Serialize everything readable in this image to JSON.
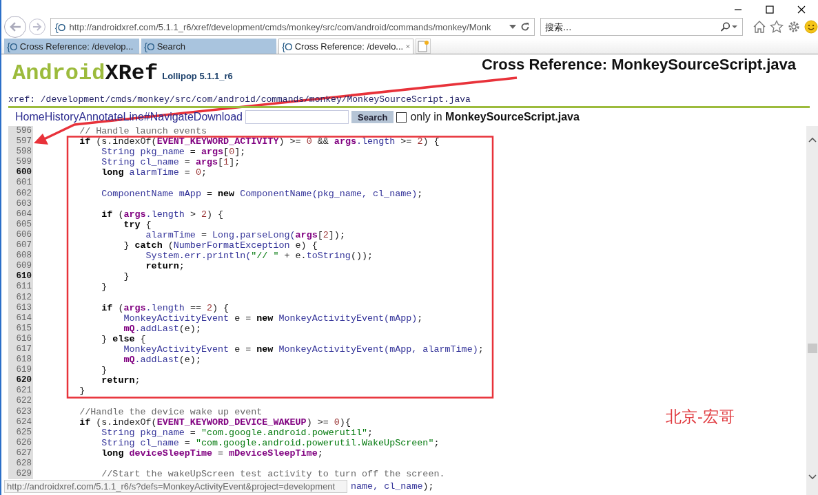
{
  "browser": {
    "url": "http://androidxref.com/5.1.1_r6/xref/development/cmds/monkey/src/com/android/commands/monkey/Monk",
    "url_favicon": "{O",
    "search": {
      "placeholder": "搜索..."
    }
  },
  "tabs": [
    {
      "favicon": "{O",
      "label": "Cross Reference: /develop...",
      "selected": false
    },
    {
      "favicon": "{O",
      "label": "Search",
      "selected": false
    },
    {
      "favicon": "{O",
      "label": "Cross Reference: /develo...",
      "selected": true
    }
  ],
  "header": {
    "logo": {
      "prefix": "Android",
      "suffix": "XRef"
    },
    "version": "Lollipop 5.1.1_r6",
    "title": "Cross Reference: MonkeySourceScript.java",
    "breadcrumb": "xref: /development/cmds/monkey/src/com/android/commands/monkey/MonkeySourceScript.java"
  },
  "nav": {
    "links": [
      "Home",
      "History",
      "Annotate",
      "Line#",
      "Navigate",
      "Download"
    ],
    "search_button": "Search",
    "only_checked": false,
    "only_label": "only in **MonkeySourceScript.java**"
  },
  "code": [
    {
      "num": "596",
      "bold": false,
      "segs": [
        {
          "kind": "comment",
          "text": "    // Handle launch events"
        }
      ]
    },
    {
      "num": "597",
      "bold": false,
      "segs": [
        {
          "kind": "keyword",
          "text": "    if"
        },
        {
          "kind": "plain",
          "text": " (s.indexOf("
        },
        {
          "kind": "field",
          "text": "EVENT_KEYWORD_ACTIVITY"
        },
        {
          "kind": "plain",
          "text": ") >= "
        },
        {
          "kind": "number",
          "text": "0"
        },
        {
          "kind": "plain",
          "text": " && "
        },
        {
          "kind": "field",
          "text": "args"
        },
        {
          "kind": "ident",
          "text": ".length"
        },
        {
          "kind": "plain",
          "text": " >= "
        },
        {
          "kind": "number",
          "text": "2"
        },
        {
          "kind": "plain",
          "text": ") {"
        }
      ]
    },
    {
      "num": "598",
      "bold": false,
      "segs": [
        {
          "kind": "ident",
          "text": "        String pkg_name"
        },
        {
          "kind": "plain",
          "text": " = "
        },
        {
          "kind": "field",
          "text": "args"
        },
        {
          "kind": "plain",
          "text": "["
        },
        {
          "kind": "number",
          "text": "0"
        },
        {
          "kind": "plain",
          "text": "];"
        }
      ]
    },
    {
      "num": "599",
      "bold": false,
      "segs": [
        {
          "kind": "ident",
          "text": "        String cl_name"
        },
        {
          "kind": "plain",
          "text": " = "
        },
        {
          "kind": "field",
          "text": "args"
        },
        {
          "kind": "plain",
          "text": "["
        },
        {
          "kind": "number",
          "text": "1"
        },
        {
          "kind": "plain",
          "text": "];"
        }
      ]
    },
    {
      "num": "600",
      "bold": true,
      "segs": [
        {
          "kind": "keyword",
          "text": "        long"
        },
        {
          "kind": "ident",
          "text": " alarmTime"
        },
        {
          "kind": "plain",
          "text": " = "
        },
        {
          "kind": "number",
          "text": "0"
        },
        {
          "kind": "plain",
          "text": ";"
        }
      ]
    },
    {
      "num": "601",
      "bold": false
    },
    {
      "num": "602",
      "bold": false,
      "segs": [
        {
          "kind": "ident",
          "text": "        ComponentName mApp"
        },
        {
          "kind": "plain",
          "text": " = "
        },
        {
          "kind": "keyword",
          "text": "new"
        },
        {
          "kind": "ident",
          "text": " ComponentName(pkg_name, cl_name)"
        },
        {
          "kind": "plain",
          "text": ";"
        }
      ]
    },
    {
      "num": "603",
      "bold": false
    },
    {
      "num": "604",
      "bold": false,
      "segs": [
        {
          "kind": "keyword",
          "text": "        if"
        },
        {
          "kind": "plain",
          "text": " ("
        },
        {
          "kind": "field",
          "text": "args"
        },
        {
          "kind": "ident",
          "text": ".length"
        },
        {
          "kind": "plain",
          "text": " > "
        },
        {
          "kind": "number",
          "text": "2"
        },
        {
          "kind": "plain",
          "text": ") {"
        }
      ]
    },
    {
      "num": "605",
      "bold": false,
      "segs": [
        {
          "kind": "keyword",
          "text": "            try"
        },
        {
          "kind": "plain",
          "text": " {"
        }
      ]
    },
    {
      "num": "606",
      "bold": false,
      "segs": [
        {
          "kind": "ident",
          "text": "                alarmTime"
        },
        {
          "kind": "plain",
          "text": " = "
        },
        {
          "kind": "ident",
          "text": "Long.parseLong("
        },
        {
          "kind": "field",
          "text": "args"
        },
        {
          "kind": "plain",
          "text": "["
        },
        {
          "kind": "number",
          "text": "2"
        },
        {
          "kind": "plain",
          "text": "]);"
        }
      ]
    },
    {
      "num": "607",
      "bold": false,
      "segs": [
        {
          "kind": "plain",
          "text": "            } "
        },
        {
          "kind": "keyword",
          "text": "catch"
        },
        {
          "kind": "plain",
          "text": " ("
        },
        {
          "kind": "ident",
          "text": "NumberFormatException"
        },
        {
          "kind": "plain",
          "text": " e) {"
        }
      ]
    },
    {
      "num": "608",
      "bold": false,
      "segs": [
        {
          "kind": "ident",
          "text": "                System.err.println("
        },
        {
          "kind": "string",
          "text": "\"// \""
        },
        {
          "kind": "plain",
          "text": " + e."
        },
        {
          "kind": "ident",
          "text": "toString"
        },
        {
          "kind": "plain",
          "text": "());"
        }
      ]
    },
    {
      "num": "609",
      "bold": false,
      "segs": [
        {
          "kind": "keyword",
          "text": "                return"
        },
        {
          "kind": "plain",
          "text": ";"
        }
      ]
    },
    {
      "num": "610",
      "bold": true,
      "segs": [
        {
          "kind": "plain",
          "text": "            }"
        }
      ]
    },
    {
      "num": "611",
      "bold": false,
      "segs": [
        {
          "kind": "plain",
          "text": "        }"
        }
      ]
    },
    {
      "num": "612",
      "bold": false
    },
    {
      "num": "613",
      "bold": false,
      "segs": [
        {
          "kind": "keyword",
          "text": "        if"
        },
        {
          "kind": "plain",
          "text": " ("
        },
        {
          "kind": "field",
          "text": "args"
        },
        {
          "kind": "ident",
          "text": ".length"
        },
        {
          "kind": "plain",
          "text": " == "
        },
        {
          "kind": "number",
          "text": "2"
        },
        {
          "kind": "plain",
          "text": ") {"
        }
      ]
    },
    {
      "num": "614",
      "bold": false,
      "segs": [
        {
          "kind": "ident",
          "text": "            MonkeyActivityEvent"
        },
        {
          "kind": "plain",
          "text": " e = "
        },
        {
          "kind": "keyword",
          "text": "new"
        },
        {
          "kind": "ident",
          "text": " MonkeyActivityEvent(mApp)"
        },
        {
          "kind": "plain",
          "text": ";"
        }
      ]
    },
    {
      "num": "615",
      "bold": false,
      "segs": [
        {
          "kind": "field",
          "text": "            mQ"
        },
        {
          "kind": "ident",
          "text": ".addLast"
        },
        {
          "kind": "plain",
          "text": "(e);"
        }
      ]
    },
    {
      "num": "616",
      "bold": false,
      "segs": [
        {
          "kind": "plain",
          "text": "        } "
        },
        {
          "kind": "keyword",
          "text": "else"
        },
        {
          "kind": "plain",
          "text": " {"
        }
      ]
    },
    {
      "num": "617",
      "bold": false,
      "segs": [
        {
          "kind": "ident",
          "text": "            MonkeyActivityEvent"
        },
        {
          "kind": "plain",
          "text": " e = "
        },
        {
          "kind": "keyword",
          "text": "new"
        },
        {
          "kind": "ident",
          "text": " MonkeyActivityEvent(mApp, alarmTime)"
        },
        {
          "kind": "plain",
          "text": ";"
        }
      ]
    },
    {
      "num": "618",
      "bold": false,
      "segs": [
        {
          "kind": "field",
          "text": "            mQ"
        },
        {
          "kind": "ident",
          "text": ".addLast"
        },
        {
          "kind": "plain",
          "text": "(e);"
        }
      ]
    },
    {
      "num": "619",
      "bold": false,
      "segs": [
        {
          "kind": "plain",
          "text": "        }"
        }
      ]
    },
    {
      "num": "620",
      "bold": true,
      "segs": [
        {
          "kind": "keyword",
          "text": "        return"
        },
        {
          "kind": "plain",
          "text": ";"
        }
      ]
    },
    {
      "num": "621",
      "bold": false,
      "segs": [
        {
          "kind": "plain",
          "text": "    }"
        }
      ]
    },
    {
      "num": "622",
      "bold": false
    },
    {
      "num": "623",
      "bold": false,
      "segs": [
        {
          "kind": "comment",
          "text": "    //Handle the device wake up event"
        }
      ]
    },
    {
      "num": "624",
      "bold": false,
      "segs": [
        {
          "kind": "keyword",
          "text": "    if"
        },
        {
          "kind": "plain",
          "text": " (s.indexOf("
        },
        {
          "kind": "field",
          "text": "EVENT_KEYWORD_DEVICE_WAKEUP"
        },
        {
          "kind": "plain",
          "text": ") >= "
        },
        {
          "kind": "number",
          "text": "0"
        },
        {
          "kind": "plain",
          "text": "){"
        }
      ]
    },
    {
      "num": "625",
      "bold": false,
      "segs": [
        {
          "kind": "ident",
          "text": "        String pkg_name"
        },
        {
          "kind": "plain",
          "text": " = "
        },
        {
          "kind": "string",
          "text": "\"com.google.android.powerutil\""
        },
        {
          "kind": "plain",
          "text": ";"
        }
      ]
    },
    {
      "num": "626",
      "bold": false,
      "segs": [
        {
          "kind": "ident",
          "text": "        String cl_name"
        },
        {
          "kind": "plain",
          "text": " = "
        },
        {
          "kind": "string",
          "text": "\"com.google.android.powerutil.WakeUpScreen\""
        },
        {
          "kind": "plain",
          "text": ";"
        }
      ]
    },
    {
      "num": "627",
      "bold": false,
      "segs": [
        {
          "kind": "keyword",
          "text": "        long"
        },
        {
          "kind": "field",
          "text": " deviceSleepTime"
        },
        {
          "kind": "plain",
          "text": " = "
        },
        {
          "kind": "field",
          "text": "mDeviceSleepTime"
        },
        {
          "kind": "plain",
          "text": ";"
        }
      ]
    },
    {
      "num": "628",
      "bold": false
    },
    {
      "num": "629",
      "bold": false,
      "segs": [
        {
          "kind": "comment",
          "text": "        //Start the wakeUpScreen test activity to turn off the screen."
        }
      ]
    }
  ],
  "status": {
    "tooltip": "http://androidxref.com/5.1.1_r6/s?defs=MonkeyActivityEvent&project=development",
    "code_behind": [
      {
        "kind": "ident",
        "text": "name, cl_name"
      },
      {
        "kind": "plain",
        "text": ");"
      }
    ]
  },
  "annotation": {
    "caption": "北京-宏哥"
  }
}
